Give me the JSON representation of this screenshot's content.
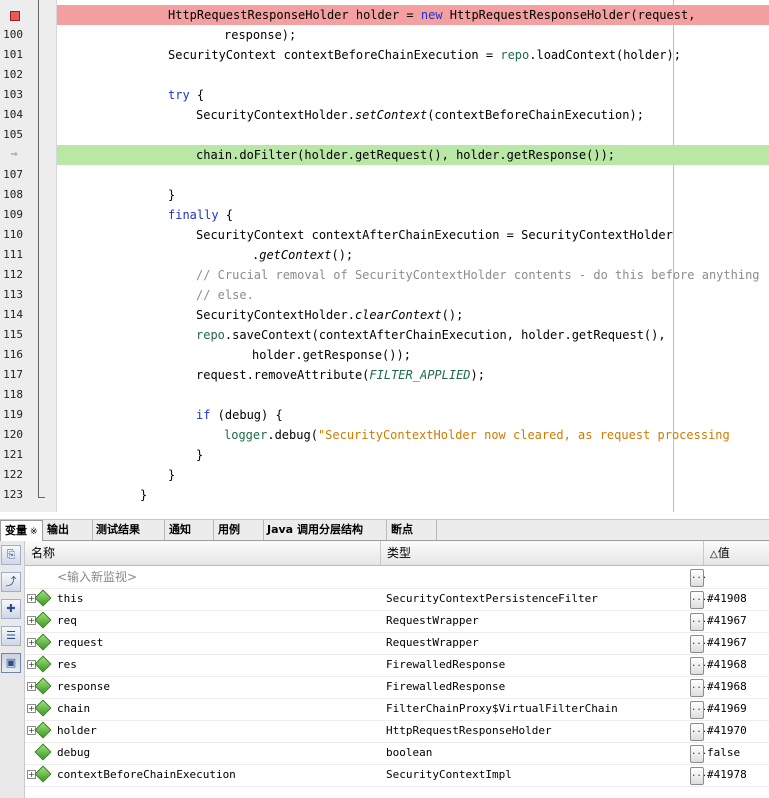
{
  "editor": {
    "lines": [
      {
        "num": "",
        "marker": "breakpoint",
        "highlight": "breakpoint",
        "indent": 8,
        "parts": [
          [
            "HttpRequestResponseHolder holder = ",
            ""
          ],
          [
            "new",
            "kw"
          ],
          [
            " HttpRequestResponseHolder(request,",
            ""
          ]
        ]
      },
      {
        "num": "100",
        "indent": 16,
        "parts": [
          [
            "response);",
            ""
          ]
        ]
      },
      {
        "num": "101",
        "indent": 8,
        "parts": [
          [
            "SecurityContext contextBeforeChainExecution = ",
            ""
          ],
          [
            "repo",
            "fld"
          ],
          [
            ".loadContext(holder);",
            ""
          ]
        ]
      },
      {
        "num": "102",
        "indent": 0,
        "parts": []
      },
      {
        "num": "103",
        "indent": 8,
        "parts": [
          [
            "try",
            "kw"
          ],
          [
            " {",
            ""
          ]
        ]
      },
      {
        "num": "104",
        "indent": 12,
        "parts": [
          [
            "SecurityContextHolder.",
            ""
          ],
          [
            "setContext",
            "it"
          ],
          [
            "(contextBeforeChainExecution);",
            ""
          ]
        ]
      },
      {
        "num": "105",
        "indent": 0,
        "parts": []
      },
      {
        "num": "",
        "marker": "current",
        "highlight": "current",
        "indent": 12,
        "parts": [
          [
            "chain.doFilter(holder.getRequest(), holder.getResponse());",
            ""
          ]
        ]
      },
      {
        "num": "107",
        "indent": 0,
        "parts": []
      },
      {
        "num": "108",
        "indent": 8,
        "parts": [
          [
            "}",
            ""
          ]
        ]
      },
      {
        "num": "109",
        "indent": 8,
        "parts": [
          [
            "finally",
            "kw"
          ],
          [
            " {",
            ""
          ]
        ]
      },
      {
        "num": "110",
        "indent": 12,
        "parts": [
          [
            "SecurityContext contextAfterChainExecution = SecurityContextHolder",
            ""
          ]
        ]
      },
      {
        "num": "111",
        "indent": 20,
        "parts": [
          [
            ".",
            ""
          ],
          [
            "getContext",
            "it"
          ],
          [
            "();",
            ""
          ]
        ]
      },
      {
        "num": "112",
        "indent": 12,
        "parts": [
          [
            "// Crucial removal of SecurityContextHolder contents - do this before anything",
            "cm"
          ]
        ]
      },
      {
        "num": "113",
        "indent": 12,
        "parts": [
          [
            "// else.",
            "cm"
          ]
        ]
      },
      {
        "num": "114",
        "indent": 12,
        "parts": [
          [
            "SecurityContextHolder.",
            ""
          ],
          [
            "clearContext",
            "it"
          ],
          [
            "();",
            ""
          ]
        ]
      },
      {
        "num": "115",
        "indent": 12,
        "parts": [
          [
            "repo",
            "fld"
          ],
          [
            ".saveContext(contextAfterChainExecution, holder.getRequest(),",
            ""
          ]
        ]
      },
      {
        "num": "116",
        "indent": 20,
        "parts": [
          [
            "holder.getResponse());",
            ""
          ]
        ]
      },
      {
        "num": "117",
        "indent": 12,
        "parts": [
          [
            "request.removeAttribute(",
            ""
          ],
          [
            "FILTER_APPLIED",
            "fld it"
          ],
          [
            ");",
            ""
          ]
        ]
      },
      {
        "num": "118",
        "indent": 0,
        "parts": []
      },
      {
        "num": "119",
        "indent": 12,
        "parts": [
          [
            "if",
            "kw"
          ],
          [
            " (debug) {",
            ""
          ]
        ]
      },
      {
        "num": "120",
        "indent": 16,
        "parts": [
          [
            "logger",
            "fld"
          ],
          [
            ".debug(",
            ""
          ],
          [
            "\"SecurityContextHolder now cleared, as request processing",
            "st"
          ]
        ]
      },
      {
        "num": "121",
        "indent": 12,
        "parts": [
          [
            "}",
            ""
          ]
        ]
      },
      {
        "num": "122",
        "indent": 8,
        "parts": [
          [
            "}",
            ""
          ]
        ]
      },
      {
        "num": "123",
        "indent": 4,
        "fold_end": true,
        "parts": [
          [
            "}",
            ""
          ]
        ]
      }
    ]
  },
  "tabs": [
    {
      "label": "变量",
      "close": "※",
      "active": true
    },
    {
      "label": "输出"
    },
    {
      "label": "测试结果"
    },
    {
      "label": "通知"
    },
    {
      "label": "用例"
    },
    {
      "label": "Java 调用分层结构"
    },
    {
      "label": "断点"
    }
  ],
  "side_tools": [
    "watch-icon",
    "step-icon",
    "add-watch-icon",
    "settings-icon",
    "view-icon"
  ],
  "variables": {
    "headers": {
      "name": "名称",
      "type": "类型",
      "value": "值",
      "sort_arrow": "△"
    },
    "new_watch": "<输入新监视>",
    "rows": [
      {
        "name": "this",
        "type": "SecurityContextPersistenceFilter",
        "value": "#41908",
        "expandable": true
      },
      {
        "name": "req",
        "type": "RequestWrapper",
        "value": "#41967",
        "expandable": true
      },
      {
        "name": "request",
        "type": "RequestWrapper",
        "value": "#41967",
        "expandable": true
      },
      {
        "name": "res",
        "type": "FirewalledResponse",
        "value": "#41968",
        "expandable": true
      },
      {
        "name": "response",
        "type": "FirewalledResponse",
        "value": "#41968",
        "expandable": true
      },
      {
        "name": "chain",
        "type": "FilterChainProxy$VirtualFilterChain",
        "value": "#41969",
        "expandable": true
      },
      {
        "name": "holder",
        "type": "HttpRequestResponseHolder",
        "value": "#41970",
        "expandable": true
      },
      {
        "name": "debug",
        "type": "boolean",
        "value": "false",
        "expandable": false
      },
      {
        "name": "contextBeforeChainExecution",
        "type": "SecurityContextImpl",
        "value": "#41978",
        "expandable": true
      }
    ],
    "ellipsis": "..."
  },
  "colors": {
    "breakpoint": "#f4a0a0",
    "current": "#b9e8a6",
    "keyword": "#1e32d2",
    "field": "#1f6b45",
    "comment": "#8c8c8c",
    "string": "#ce7b00"
  }
}
